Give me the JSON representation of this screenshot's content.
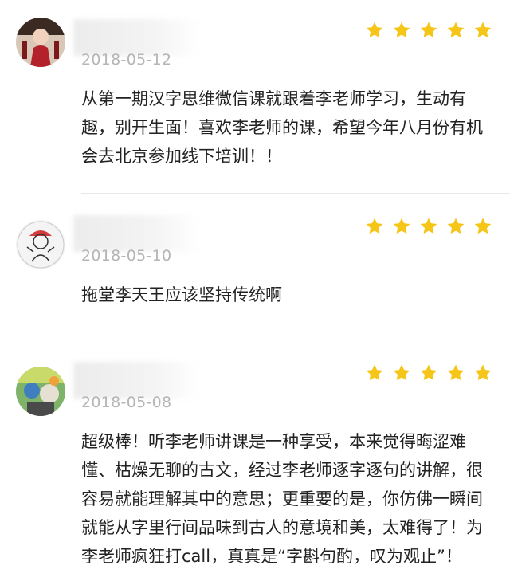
{
  "reviews": [
    {
      "date": "2018-05-12",
      "rating": 5,
      "text": "从第一期汉字思维微信课就跟着李老师学习，生动有趣，别开生面！喜欢李老师的课，希望今年八月份有机会去北京参加线下培训！！"
    },
    {
      "date": "2018-05-10",
      "rating": 5,
      "text": "拖堂李天王应该坚持传统啊"
    },
    {
      "date": "2018-05-08",
      "rating": 5,
      "text": "超级棒！听李老师讲课是一种享受，本来觉得晦涩难懂、枯燥无聊的古文，经过李老师逐字逐句的讲解，很容易就能理解其中的意思；更重要的是，你仿佛一瞬间就能从字里行间品味到古人的意境和美，太难得了！为李老师疯狂打call，真真是“字斟句酌，叹为观止”！"
    }
  ],
  "colors": {
    "star": "#f5c518",
    "date": "#b5b5b5",
    "text": "#222222",
    "divider": "#e8e8e8"
  }
}
